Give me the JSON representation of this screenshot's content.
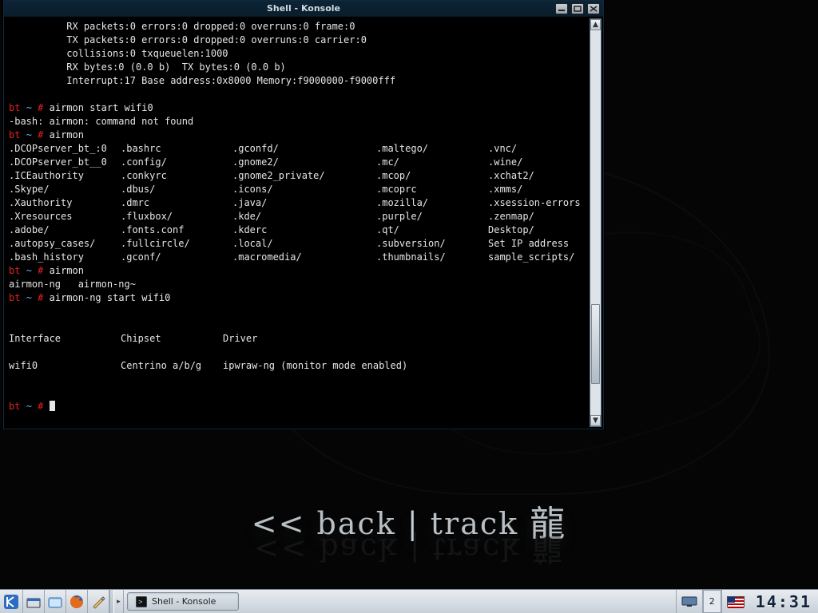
{
  "window": {
    "title": "Shell - Konsole"
  },
  "terminal": {
    "net_lines": [
      "          RX packets:0 errors:0 dropped:0 overruns:0 frame:0",
      "          TX packets:0 errors:0 dropped:0 overruns:0 carrier:0",
      "          collisions:0 txqueuelen:1000",
      "          RX bytes:0 (0.0 b)  TX bytes:0 (0.0 b)",
      "          Interrupt:17 Base address:0x8000 Memory:f9000000-f9000fff"
    ],
    "prompt_host": "bt",
    "prompt_path": "~",
    "prompt_sep": "#",
    "cmd1": "airmon start wifi0",
    "err1": "-bash: airmon: command not found",
    "cmd2": "airmon",
    "dir_rows": [
      [
        ".DCOPserver_bt_:0",
        ".bashrc",
        ".gconfd/",
        ".maltego/",
        ".vnc/"
      ],
      [
        ".DCOPserver_bt__0",
        ".config/",
        ".gnome2/",
        ".mc/",
        ".wine/"
      ],
      [
        ".ICEauthority",
        ".conkyrc",
        ".gnome2_private/",
        ".mcop/",
        ".xchat2/"
      ],
      [
        ".Skype/",
        ".dbus/",
        ".icons/",
        ".mcoprc",
        ".xmms/"
      ],
      [
        ".Xauthority",
        ".dmrc",
        ".java/",
        ".mozilla/",
        ".xsession-errors"
      ],
      [
        ".Xresources",
        ".fluxbox/",
        ".kde/",
        ".purple/",
        ".zenmap/"
      ],
      [
        ".adobe/",
        ".fonts.conf",
        ".kderc",
        ".qt/",
        "Desktop/"
      ],
      [
        ".autopsy_cases/",
        ".fullcircle/",
        ".local/",
        ".subversion/",
        "Set IP address"
      ],
      [
        ".bash_history",
        ".gconf/",
        ".macromedia/",
        ".thumbnails/",
        "sample_scripts/"
      ]
    ],
    "cmd3": "airmon",
    "airmon_list": "airmon-ng   airmon-ng~",
    "cmd4": "airmon-ng start wifi0",
    "table_headers": [
      "Interface",
      "Chipset",
      "Driver"
    ],
    "table_row": [
      "wifi0",
      "Centrino a/b/g",
      "ipwraw-ng (monitor mode enabled)"
    ]
  },
  "wallpaper": {
    "brand_prefix": "<< back",
    "brand_pipe": " | ",
    "brand_suffix": "track",
    "kanji": "龍"
  },
  "taskbar": {
    "task_label": "Shell - Konsole",
    "pager_active": "2",
    "keyboard_layout": "US",
    "clock": "14:31"
  }
}
